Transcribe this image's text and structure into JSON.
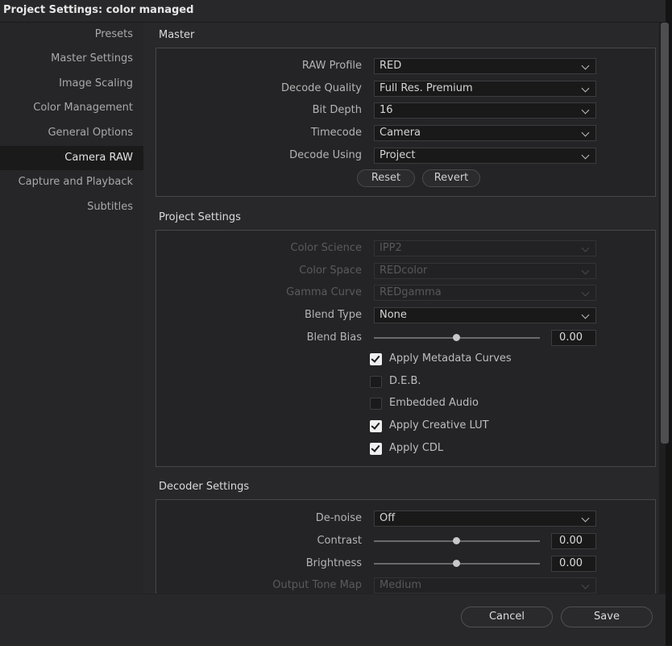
{
  "window": {
    "title": "Project Settings:  color managed"
  },
  "sidebar": {
    "items": [
      {
        "label": "Presets",
        "active": false
      },
      {
        "label": "Master Settings",
        "active": false
      },
      {
        "label": "Image Scaling",
        "active": false
      },
      {
        "label": "Color Management",
        "active": false
      },
      {
        "label": "General Options",
        "active": false
      },
      {
        "label": "Camera RAW",
        "active": true
      },
      {
        "label": "Capture and Playback",
        "active": false
      },
      {
        "label": "Subtitles",
        "active": false
      }
    ]
  },
  "master": {
    "title": "Master",
    "raw_profile": {
      "label": "RAW Profile",
      "value": "RED"
    },
    "decode_quality": {
      "label": "Decode Quality",
      "value": "Full Res. Premium"
    },
    "bit_depth": {
      "label": "Bit Depth",
      "value": "16"
    },
    "timecode": {
      "label": "Timecode",
      "value": "Camera"
    },
    "decode_using": {
      "label": "Decode Using",
      "value": "Project"
    },
    "reset_label": "Reset",
    "revert_label": "Revert"
  },
  "project_settings": {
    "title": "Project Settings",
    "color_science": {
      "label": "Color Science",
      "value": "IPP2",
      "disabled": true
    },
    "color_space": {
      "label": "Color Space",
      "value": "REDcolor",
      "disabled": true
    },
    "gamma_curve": {
      "label": "Gamma Curve",
      "value": "REDgamma",
      "disabled": true
    },
    "blend_type": {
      "label": "Blend Type",
      "value": "None"
    },
    "blend_bias": {
      "label": "Blend Bias",
      "value": "0.00",
      "slider_fraction": 0.5
    },
    "checkboxes": [
      {
        "label": "Apply Metadata Curves",
        "checked": true
      },
      {
        "label": "D.E.B.",
        "checked": false
      },
      {
        "label": "Embedded Audio",
        "checked": false
      },
      {
        "label": "Apply Creative LUT",
        "checked": true
      },
      {
        "label": "Apply CDL",
        "checked": true
      }
    ]
  },
  "decoder_settings": {
    "title": "Decoder Settings",
    "denoise": {
      "label": "De-noise",
      "value": "Off"
    },
    "contrast": {
      "label": "Contrast",
      "value": "0.00",
      "slider_fraction": 0.5
    },
    "brightness": {
      "label": "Brightness",
      "value": "0.00",
      "slider_fraction": 0.5
    },
    "output_tone_map": {
      "label": "Output Tone Map",
      "value": "Medium",
      "disabled": true
    }
  },
  "footer": {
    "cancel_label": "Cancel",
    "save_label": "Save"
  }
}
